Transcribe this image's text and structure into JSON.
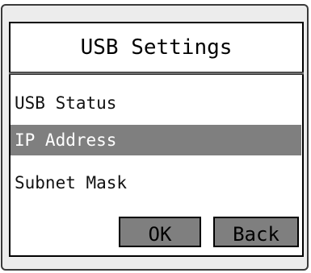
{
  "dialog": {
    "title": "USB Settings"
  },
  "menu": {
    "items": [
      {
        "label": "USB Status",
        "selected": false
      },
      {
        "label": "IP Address",
        "selected": true
      },
      {
        "label": "Subnet Mask",
        "selected": false
      }
    ]
  },
  "buttons": {
    "ok_label": "OK",
    "back_label": "Back"
  },
  "colors": {
    "selection": "#7f7f7f",
    "button": "#7f7f7f",
    "panel": "#ffffff",
    "bezel": "#ececec"
  }
}
